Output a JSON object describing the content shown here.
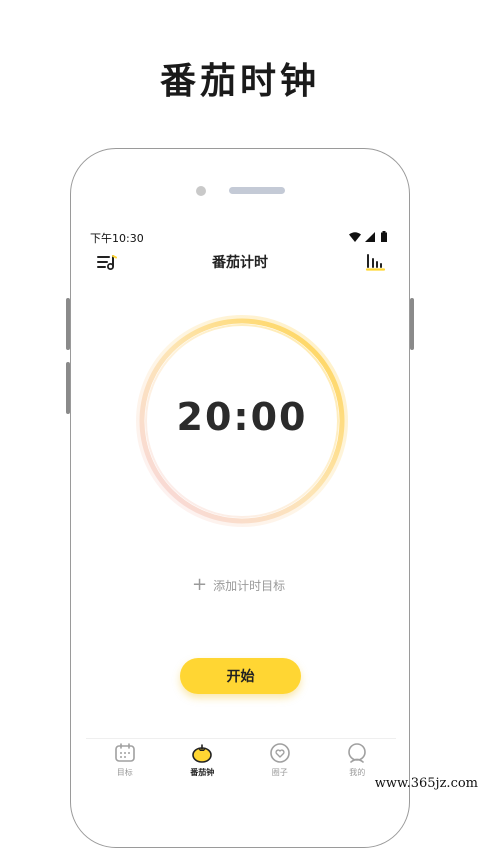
{
  "promo": {
    "title": "番茄时钟"
  },
  "status_bar": {
    "time": "下午10:30"
  },
  "header": {
    "title": "番茄计时",
    "left_icon": "music-list-icon",
    "right_icon": "bar-chart-icon"
  },
  "timer": {
    "display": "20:00"
  },
  "add_goal": {
    "label": "添加计时目标"
  },
  "start_button": {
    "label": "开始"
  },
  "tabs": [
    {
      "label": "目标",
      "icon": "calendar-icon",
      "active": false
    },
    {
      "label": "番茄钟",
      "icon": "tomato-icon",
      "active": true
    },
    {
      "label": "圈子",
      "icon": "heart-chat-icon",
      "active": false
    },
    {
      "label": "我的",
      "icon": "profile-icon",
      "active": false
    }
  ],
  "watermark": {
    "text": "www.365jz.com"
  },
  "colors": {
    "accent": "#ffd633",
    "ring_start": "#ffd34d",
    "ring_end": "#f7d6e0"
  }
}
